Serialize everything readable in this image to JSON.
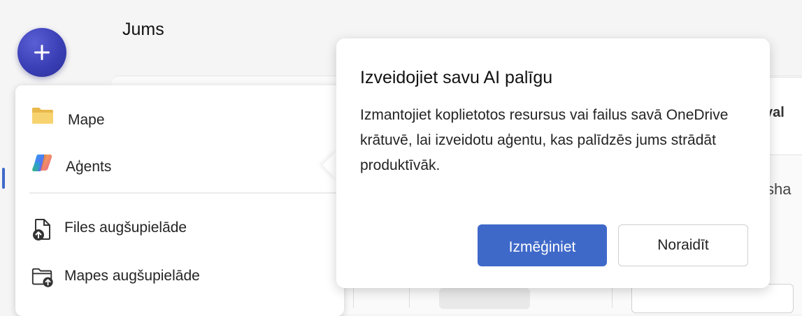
{
  "page": {
    "title": "Jums"
  },
  "create_button": {
    "icon": "plus-icon",
    "color": "#3a3fb5"
  },
  "menu": {
    "items": [
      {
        "label": "Mape",
        "icon": "folder-icon"
      },
      {
        "label": "Aģents",
        "icon": "copilot-icon"
      },
      {
        "label": "Files augšupielāde",
        "icon": "file-upload-icon"
      },
      {
        "label": "Mapes augšupielāde",
        "icon": "folder-upload-icon"
      }
    ]
  },
  "callout": {
    "title": "Izveidojiet savu AI palīgu",
    "body": "Izmantojiet koplietotos resursus vai failus savā OneDrive krātuvē, lai izveidotu aģentu, kas palīdzēs jums strādāt produktīvāk.",
    "primary_label": "Izmēģiniet",
    "secondary_label": "Noraidīt",
    "accent_color": "#3f69c9"
  },
  "background": {
    "right_card_text": "val",
    "right_text": "l sha"
  }
}
